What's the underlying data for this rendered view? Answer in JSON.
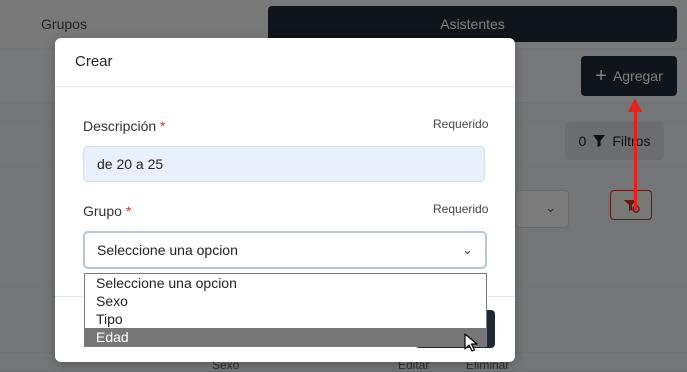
{
  "background": {
    "tabs": [
      {
        "label": "Grupos",
        "active": false
      },
      {
        "label": "Asistentes",
        "active": true
      }
    ],
    "add_button_label": "Agregar",
    "filter_button": {
      "count": "0",
      "label": "Filtros"
    },
    "bottom_texts": [
      "Sexo",
      "Editar",
      "Eliminar"
    ]
  },
  "modal": {
    "title": "Crear",
    "fields": [
      {
        "label": "Descripción",
        "required_mark": "*",
        "required_text": "Requerido",
        "value": "de 20 a 25"
      },
      {
        "label": "Grupo",
        "required_mark": "*",
        "required_text": "Requerido",
        "value": "Seleccione una opcion"
      }
    ]
  },
  "dropdown": {
    "options": [
      "Seleccione una opcion",
      "Sexo",
      "Tipo",
      "Edad"
    ],
    "highlighted_index": 3
  },
  "colors": {
    "primary_dark": "#1f2a37",
    "annotation_arrow": "#e8201a",
    "input_autofill": "#e8f0fe",
    "option_highlight": "#767676"
  }
}
